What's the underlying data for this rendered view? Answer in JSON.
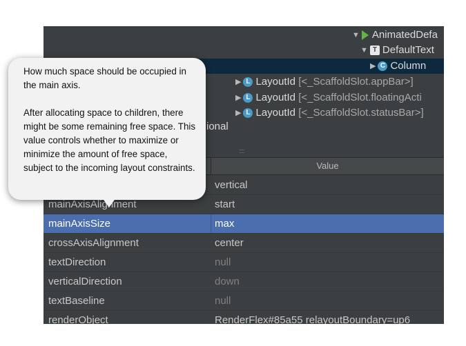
{
  "tree": {
    "nodes": [
      {
        "label": "AnimatedDefa",
        "icon": "animated-icon"
      },
      {
        "label": "DefaultText",
        "icon": "text-icon",
        "icon_letter": "T"
      },
      {
        "label": "Column",
        "icon": "column-icon",
        "icon_letter": "C"
      },
      {
        "label": "LayoutId",
        "detail": "[<_ScaffoldSlot.appBar>]",
        "icon": "layout-icon",
        "icon_letter": "L"
      },
      {
        "label": "LayoutId",
        "detail": "[<_ScaffoldSlot.floatingActi",
        "icon": "layout-icon",
        "icon_letter": "L"
      },
      {
        "label": "LayoutId",
        "detail": "[<_ScaffoldSlot.statusBar>]",
        "icon": "layout-icon",
        "icon_letter": "L"
      }
    ],
    "partial_text": "ional",
    "grip": ":::::"
  },
  "properties": {
    "value_header": "Value",
    "rows": [
      {
        "name": "",
        "value": "vertical"
      },
      {
        "name": "mainAxisAlignment",
        "value": "start"
      },
      {
        "name": "mainAxisSize",
        "value": "max"
      },
      {
        "name": "crossAxisAlignment",
        "value": "center"
      },
      {
        "name": "textDirection",
        "value": "null"
      },
      {
        "name": "verticalDirection",
        "value": "down"
      },
      {
        "name": "textBaseline",
        "value": "null"
      },
      {
        "name": "renderObject",
        "value": "RenderFlex#85a55 relayoutBoundary=up6"
      }
    ]
  },
  "tooltip": {
    "para1": "How much space should be occupied in the main axis.",
    "para2": "After allocating space to children, there might be some remaining free space. This value controls whether to maximize or minimize the amount of free space, subject to the incoming layout constraints."
  },
  "colors": {
    "panel_bg": "#3c3f41",
    "selection": "#4b6eaf",
    "tree_selection": "#0d293e",
    "tooltip_bg": "#f2f2f2",
    "icon_blue": "#4a9ac9",
    "icon_green": "#62b543"
  }
}
